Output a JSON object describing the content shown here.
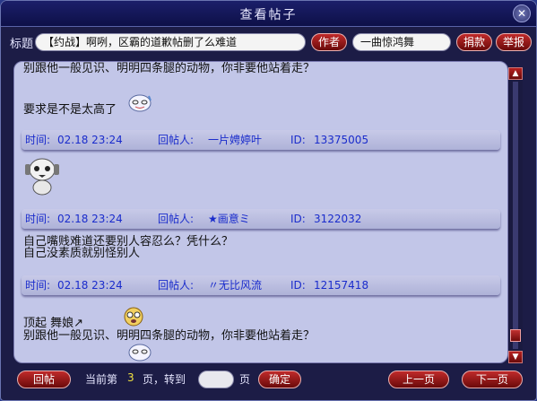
{
  "window": {
    "title": "查看帖子",
    "close_icon": "close-icon"
  },
  "topic": {
    "label": "标题",
    "title": "【约战】啊咧，区霸的道歉帖删了么难道",
    "author_button": "作者",
    "author_name": "一曲惊鸿舞",
    "donate_button": "捐款",
    "report_button": "举报"
  },
  "posts": [
    {
      "lines": [
        "别跟他一般见识、明明四条腿的动物，你非要他站着走？",
        "要求是不是太高了"
      ],
      "meta": {
        "time_label": "时间:",
        "time": "02.18 23:24",
        "poster_label": "回帖人:",
        "poster": "一片娉婷叶",
        "id_label": "ID:",
        "id": "13375005"
      }
    },
    {
      "lines": [],
      "meta": {
        "time_label": "时间:",
        "time": "02.18 23:24",
        "poster_label": "回帖人:",
        "poster": "★画意ミ",
        "id_label": "ID:",
        "id": "3122032"
      }
    },
    {
      "lines": [
        "自己嘴贱难道还要别人容忍么？凭什么？",
        "自己没素质就别怪别人"
      ],
      "meta": {
        "time_label": "时间:",
        "time": "02.18 23:24",
        "poster_label": "回帖人:",
        "poster": "〃无比风流",
        "id_label": "ID:",
        "id": "12157418"
      }
    },
    {
      "lines": [
        "顶起  舞娘↗",
        "别跟他一般见识、明明四条腿的动物，你非要他站着走？"
      ],
      "meta": null
    }
  ],
  "footer": {
    "reply_button": "回帖",
    "current_prefix": "当前第",
    "current_page": "3",
    "goto_label": "页，转到",
    "page_suffix": "页",
    "confirm_button": "确定",
    "prev_button": "上一页",
    "next_button": "下一页"
  },
  "colors": {
    "meta_text": "#1a2ccc",
    "button_red": "#a01818",
    "content_bg": "#c2c6e8"
  }
}
